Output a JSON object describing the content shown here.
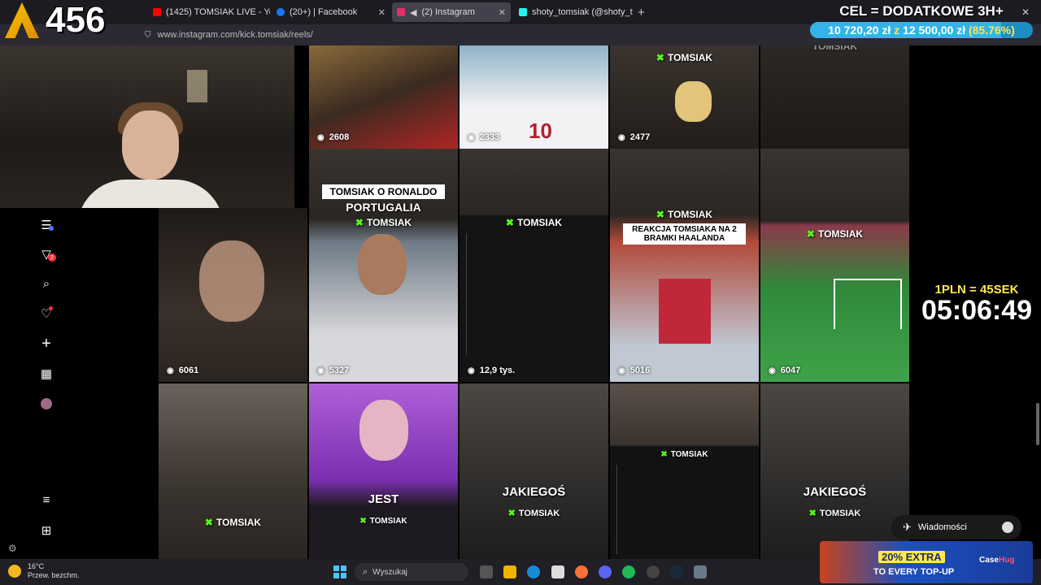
{
  "overlay": {
    "counter": "456",
    "goal_title": "CEL = DODATKOWE 3H+",
    "goal_current": "10 720,20 zł",
    "goal_sep": "z",
    "goal_target": "12 500,00 zł",
    "goal_percent_label": "(85.76%)",
    "goal_progress": 0.8576,
    "timer_rate": "1PLN = 45SEK",
    "timer_value": "05:06:49"
  },
  "browser": {
    "tabs": [
      {
        "label": "(1425) TOMSIAK LIVE - YouTube",
        "favicon_color": "#ff0000"
      },
      {
        "label": "(20+) | Facebook",
        "favicon_color": "#1877f2"
      },
      {
        "label": "(2) Instagram",
        "favicon_color": "#e1306c",
        "active": true
      },
      {
        "label": "shoty_tomsiak (@shoty_tomsiak",
        "favicon_color": "#25f4ee"
      }
    ],
    "url": "www.instagram.com/kick.tomsiak/reels/"
  },
  "instagram": {
    "sidebar_icons": [
      "threads-icon",
      "heart-filter-icon",
      "search-icon",
      "heart-icon",
      "plus-icon",
      "stats-icon",
      "avatar-icon",
      "menu-icon",
      "grid-icon"
    ],
    "notification_badge": "2",
    "reels": [
      {
        "views": "2608"
      },
      {
        "views": "2333"
      },
      {
        "views": "2477",
        "tag": "TOMSIAK"
      },
      {
        "views": "",
        "tag": "TOMSIAK"
      },
      {
        "views": "6061"
      },
      {
        "views": "5327",
        "caption": "TOMSIAK O RONALDO",
        "title": "PORTUGALIA",
        "tag": "TOMSIAK"
      },
      {
        "views": "12,9 tys.",
        "tag": "TOMSIAK"
      },
      {
        "views": "5016",
        "tag": "TOMSIAK",
        "caption": "REAKCJA TOMSIAKA NA 2 BRAMKI HAALANDA"
      },
      {
        "views": "6047",
        "tag": "TOMSIAK"
      },
      {
        "views": "",
        "tag": "TOMSIAK"
      },
      {
        "views": "",
        "word": "JEST",
        "tag": "TOMSIAK"
      },
      {
        "views": "",
        "word": "JAKIEGOŚ",
        "tag": "TOMSIAK"
      },
      {
        "views": "",
        "tag": "TOMSIAK"
      },
      {
        "views": "",
        "word": "JAKIEGOŚ",
        "tag": "TOMSIAK"
      }
    ],
    "messages_label": "Wiadomości"
  },
  "promo": {
    "headline": "20% EXTRA",
    "subline": "TO EVERY TOP-UP",
    "brand_a": "Case",
    "brand_b": "Hug"
  },
  "taskbar": {
    "temperature": "16°C",
    "weather_desc": "Przew. bezchm.",
    "search_placeholder": "Wyszukaj"
  },
  "colors": {
    "kick_green": "#53fc18",
    "accent_blue": "#35b3e8",
    "notification_red": "#ff3040"
  }
}
